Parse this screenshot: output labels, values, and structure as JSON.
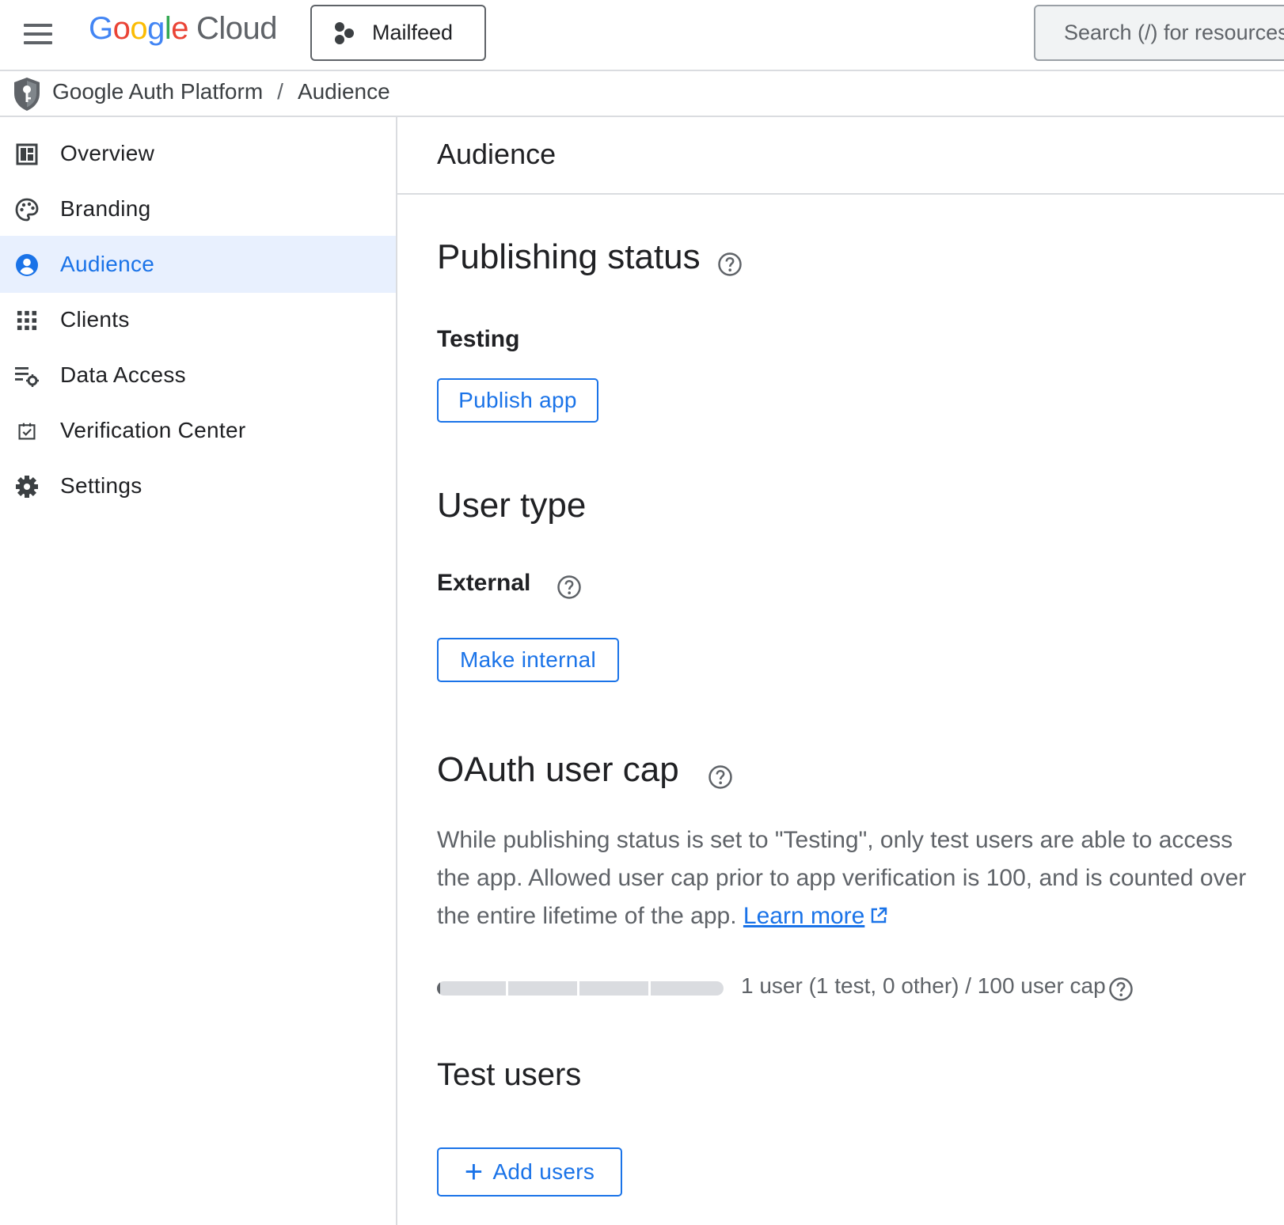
{
  "topbar": {
    "logo_letters": [
      "G",
      "o",
      "o",
      "g",
      "l",
      "e"
    ],
    "logo_suffix": "Cloud",
    "project_name": "Mailfeed",
    "search_placeholder": "Search (/) for resources"
  },
  "breadcrumb": {
    "items": [
      "Google Auth Platform",
      "Audience"
    ],
    "separator": "/"
  },
  "sidebar": {
    "items": [
      {
        "label": "Overview",
        "icon": "dashboard-icon"
      },
      {
        "label": "Branding",
        "icon": "palette-icon"
      },
      {
        "label": "Audience",
        "icon": "account-circle-icon",
        "active": true
      },
      {
        "label": "Clients",
        "icon": "apps-grid-icon"
      },
      {
        "label": "Data Access",
        "icon": "list-settings-icon"
      },
      {
        "label": "Verification Center",
        "icon": "checkbox-icon"
      },
      {
        "label": "Settings",
        "icon": "gear-icon"
      }
    ]
  },
  "main": {
    "title": "Audience",
    "publishing": {
      "heading": "Publishing status",
      "status": "Testing",
      "button": "Publish app"
    },
    "user_type": {
      "heading": "User type",
      "value": "External",
      "button": "Make internal"
    },
    "cap": {
      "heading": "OAuth user cap",
      "description": "While publishing status is set to \"Testing\", only test users are able to access the app. Allowed user cap prior to app verification is 100, and is counted over the entire lifetime of the app.",
      "learn_more": "Learn more",
      "usage_text": "1 user (1 test, 0 other) / 100 user cap",
      "used": 1,
      "limit": 100
    },
    "test_users": {
      "heading": "Test users",
      "button": "Add users"
    }
  },
  "colors": {
    "accent": "#1a73e8",
    "active_bg": "#e8f0fe",
    "border": "#dadce0"
  }
}
